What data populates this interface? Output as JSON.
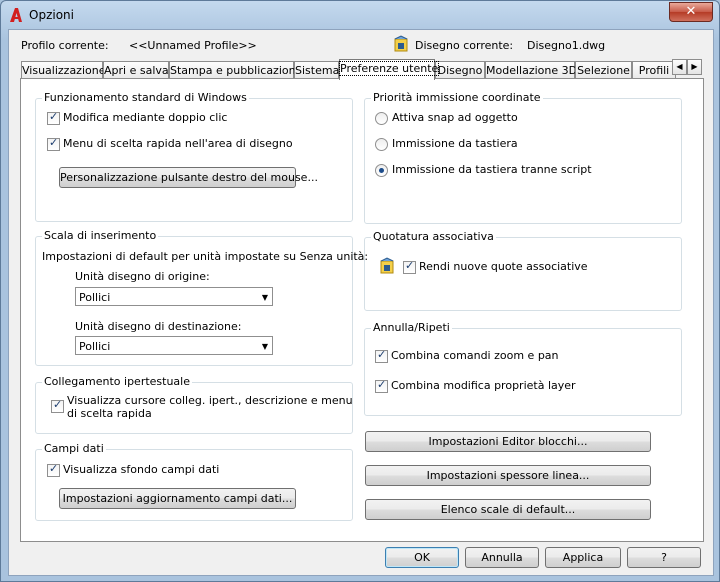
{
  "window": {
    "title": "Opzioni",
    "close_glyph": "✕"
  },
  "header": {
    "profile_label": "Profilo corrente:",
    "profile_value": "<<Unnamed Profile>>",
    "drawing_label": "Disegno corrente:",
    "drawing_value": "Disegno1.dwg"
  },
  "tabs": [
    {
      "label": "Visualizzazione"
    },
    {
      "label": "Apri e salva"
    },
    {
      "label": "Stampa e pubblicazione"
    },
    {
      "label": "Sistema"
    },
    {
      "label": "Preferenze utente",
      "active": true
    },
    {
      "label": "Disegno"
    },
    {
      "label": "Modellazione 3D"
    },
    {
      "label": "Selezione"
    },
    {
      "label": "Profili"
    }
  ],
  "tab_scroll": {
    "left": "◀",
    "right": "▶"
  },
  "windows_behavior": {
    "title": "Funzionamento standard di Windows",
    "double_click": {
      "label": "Modifica mediante doppio clic",
      "checked": true
    },
    "shortcut_menu": {
      "label": "Menu di scelta rapida nell'area di disegno",
      "checked": true
    },
    "right_click_button": "Personalizzazione pulsante destro del mouse..."
  },
  "insertion_scale": {
    "title": "Scala di inserimento",
    "description": "Impostazioni di default per unità impostate su Senza unità:",
    "source_label": "Unità disegno di origine:",
    "source_value": "Pollici",
    "target_label": "Unità disegno di destinazione:",
    "target_value": "Pollici"
  },
  "hyperlink": {
    "title": "Collegamento ipertestuale",
    "option_line1": "Visualizza cursore colleg. ipert., descrizione e menu",
    "option_line2": "di scelta rapida",
    "checked": true
  },
  "fields": {
    "title": "Campi dati",
    "background": {
      "label": "Visualizza sfondo campi dati",
      "checked": true
    },
    "update_button": "Impostazioni aggiornamento campi dati..."
  },
  "coordinate_priority": {
    "title": "Priorità immissione coordinate",
    "options": [
      {
        "label": "Attiva snap ad oggetto",
        "selected": false
      },
      {
        "label": "Immissione da tastiera",
        "selected": false
      },
      {
        "label": "Immissione da tastiera tranne script",
        "selected": true
      }
    ]
  },
  "associative_dim": {
    "title": "Quotatura associativa",
    "option": {
      "label": "Rendi nuove quote associative",
      "checked": true
    }
  },
  "undo_redo": {
    "title": "Annulla/Ripeti",
    "zoom": {
      "label": "Combina comandi zoom e pan",
      "checked": true
    },
    "layer": {
      "label": "Combina modifica proprietà layer",
      "checked": true
    }
  },
  "right_buttons": {
    "block_editor": "Impostazioni Editor blocchi...",
    "lineweight": "Impostazioni spessore linea...",
    "scale_list": "Elenco scale di default..."
  },
  "footer": {
    "ok": "OK",
    "cancel": "Annulla",
    "apply": "Applica",
    "help": "?"
  }
}
